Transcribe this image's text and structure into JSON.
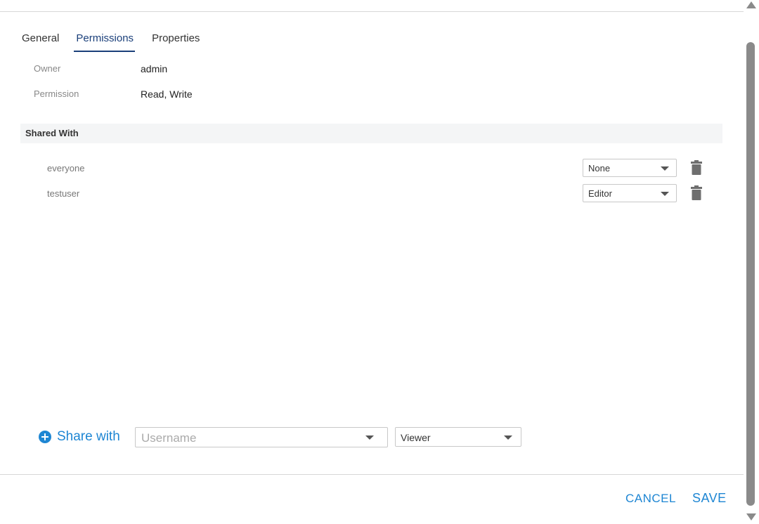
{
  "tabs": [
    {
      "label": "General",
      "active": false
    },
    {
      "label": "Permissions",
      "active": true
    },
    {
      "label": "Properties",
      "active": false
    }
  ],
  "info": {
    "owner_label": "Owner",
    "owner_value": "admin",
    "permission_label": "Permission",
    "permission_value": "Read, Write"
  },
  "shared_with": {
    "title": "Shared With",
    "entries": [
      {
        "name": "everyone",
        "role": "None"
      },
      {
        "name": "testuser",
        "role": "Editor"
      }
    ]
  },
  "share_bar": {
    "button_label": "Share with",
    "username_placeholder": "Username",
    "username_value": "",
    "role_value": "Viewer"
  },
  "footer": {
    "cancel_label": "CANCEL",
    "save_label": "SAVE"
  },
  "colors": {
    "accent": "#1e86d3",
    "tab_active": "#1a3f7a",
    "section_bg": "#f4f5f6"
  }
}
